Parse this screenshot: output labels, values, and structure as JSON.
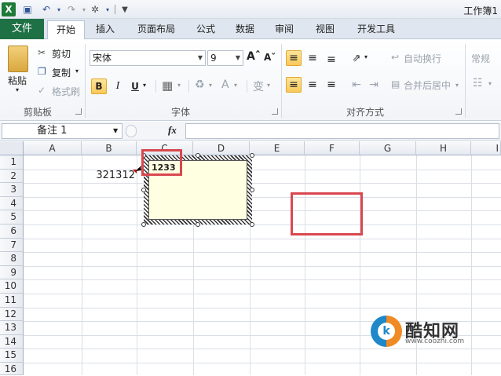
{
  "window": {
    "title": "工作簿1"
  },
  "tabs": [
    "文件",
    "开始",
    "插入",
    "页面布局",
    "公式",
    "数据",
    "审阅",
    "视图",
    "开发工具"
  ],
  "ribbon": {
    "clipboard": {
      "paste": "粘贴",
      "cut": "剪切",
      "copy": "复制",
      "format_painter": "格式刷",
      "label": "剪贴板"
    },
    "font": {
      "name": "宋体",
      "size": "9",
      "bold": "B",
      "italic": "I",
      "underline": "U",
      "label": "字体"
    },
    "alignment": {
      "wrap_text": "自动换行",
      "merge_center": "合并后居中",
      "label": "对齐方式"
    },
    "number": {
      "format": "常规"
    }
  },
  "formula_bar": {
    "name_box": "备注 1",
    "fx": "fx"
  },
  "grid": {
    "columns": [
      "A",
      "B",
      "C",
      "D",
      "E",
      "F",
      "G",
      "H",
      "I"
    ],
    "rows": [
      "1",
      "2",
      "3",
      "4",
      "5",
      "6",
      "7",
      "8",
      "9",
      "10",
      "11",
      "12",
      "13",
      "14",
      "15",
      "16"
    ],
    "cell_b2": "321312"
  },
  "comment": {
    "text": "1233"
  },
  "watermark": {
    "name": "酷知网",
    "url": "www.coozhi.com"
  },
  "colors": {
    "file_tab": "#1e7145",
    "highlight_red": "#d9484f",
    "comment_bg": "#ffffe1"
  }
}
